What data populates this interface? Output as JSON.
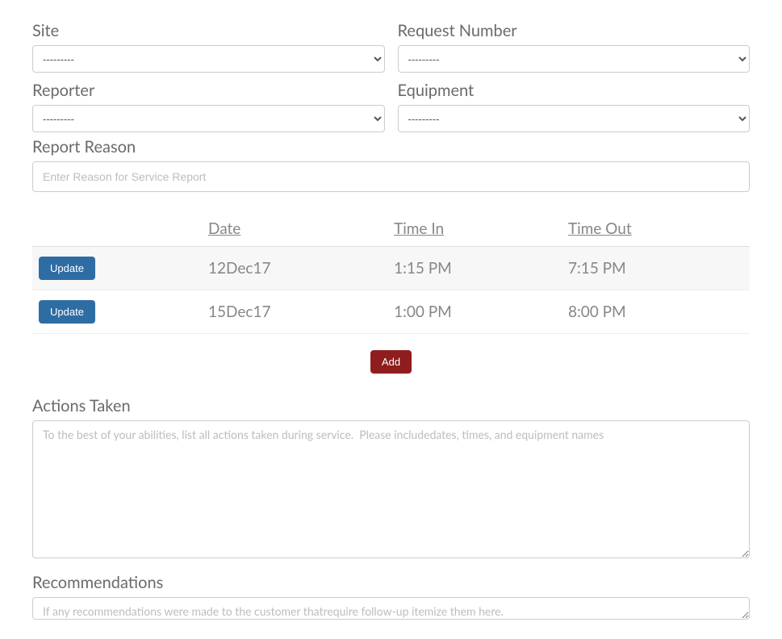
{
  "labels": {
    "site": "Site",
    "request_number": "Request Number",
    "reporter": "Reporter",
    "equipment": "Equipment",
    "report_reason": "Report Reason",
    "actions_taken": "Actions Taken",
    "recommendations": "Recommendations"
  },
  "selects": {
    "site": {
      "value": "---------"
    },
    "request_number": {
      "value": "---------"
    },
    "reporter": {
      "value": "---------"
    },
    "equipment": {
      "value": "---------"
    }
  },
  "placeholders": {
    "report_reason": "Enter Reason for Service Report",
    "actions_taken": "To the best of your abilities, list all actions taken during service.  Please includedates, times, and equipment names",
    "recommendations": "If any recommendations were made to the customer thatrequire follow-up itemize them here."
  },
  "time_table": {
    "headers": {
      "date": "Date",
      "time_in": "Time In",
      "time_out": "Time Out"
    },
    "rows": [
      {
        "action": "Update",
        "date": "12Dec17",
        "time_in": "1:15 PM",
        "time_out": "7:15 PM"
      },
      {
        "action": "Update",
        "date": "15Dec17",
        "time_in": "1:00 PM",
        "time_out": "8:00 PM"
      }
    ]
  },
  "buttons": {
    "add": "Add"
  }
}
